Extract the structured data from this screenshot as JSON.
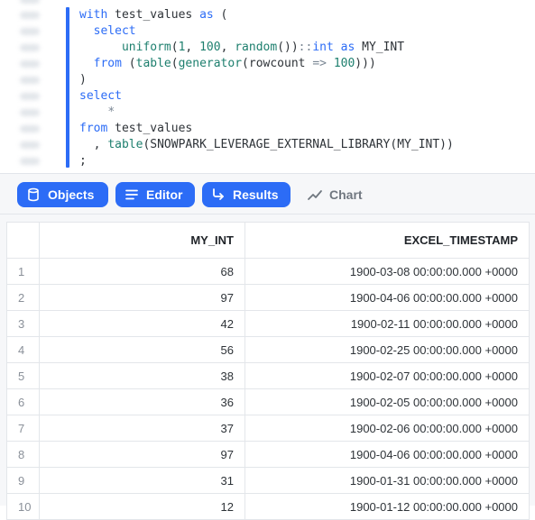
{
  "editor": {
    "code_lines": [
      "with test_values as (",
      "  select",
      "      uniform(1, 100, random())::int as MY_INT",
      "  from (table(generator(rowcount => 100)))",
      ")",
      "select",
      "    *",
      "from test_values",
      "  , table(SNOWPARK_LEVERAGE_EXTERNAL_LIBRARY(MY_INT))",
      ";"
    ]
  },
  "toolbar": {
    "objects_label": "Objects",
    "editor_label": "Editor",
    "results_label": "Results",
    "chart_label": "Chart",
    "accent_color": "#2c6cf6"
  },
  "results": {
    "columns": [
      "MY_INT",
      "EXCEL_TIMESTAMP"
    ],
    "rows": [
      {
        "n": "1",
        "my_int": "68",
        "ts": "1900-03-08 00:00:00.000 +0000"
      },
      {
        "n": "2",
        "my_int": "97",
        "ts": "1900-04-06 00:00:00.000 +0000"
      },
      {
        "n": "3",
        "my_int": "42",
        "ts": "1900-02-11 00:00:00.000 +0000"
      },
      {
        "n": "4",
        "my_int": "56",
        "ts": "1900-02-25 00:00:00.000 +0000"
      },
      {
        "n": "5",
        "my_int": "38",
        "ts": "1900-02-07 00:00:00.000 +0000"
      },
      {
        "n": "6",
        "my_int": "36",
        "ts": "1900-02-05 00:00:00.000 +0000"
      },
      {
        "n": "7",
        "my_int": "37",
        "ts": "1900-02-06 00:00:00.000 +0000"
      },
      {
        "n": "8",
        "my_int": "97",
        "ts": "1900-04-06 00:00:00.000 +0000"
      },
      {
        "n": "9",
        "my_int": "31",
        "ts": "1900-01-31 00:00:00.000 +0000"
      },
      {
        "n": "10",
        "my_int": "12",
        "ts": "1900-01-12 00:00:00.000 +0000"
      }
    ]
  }
}
